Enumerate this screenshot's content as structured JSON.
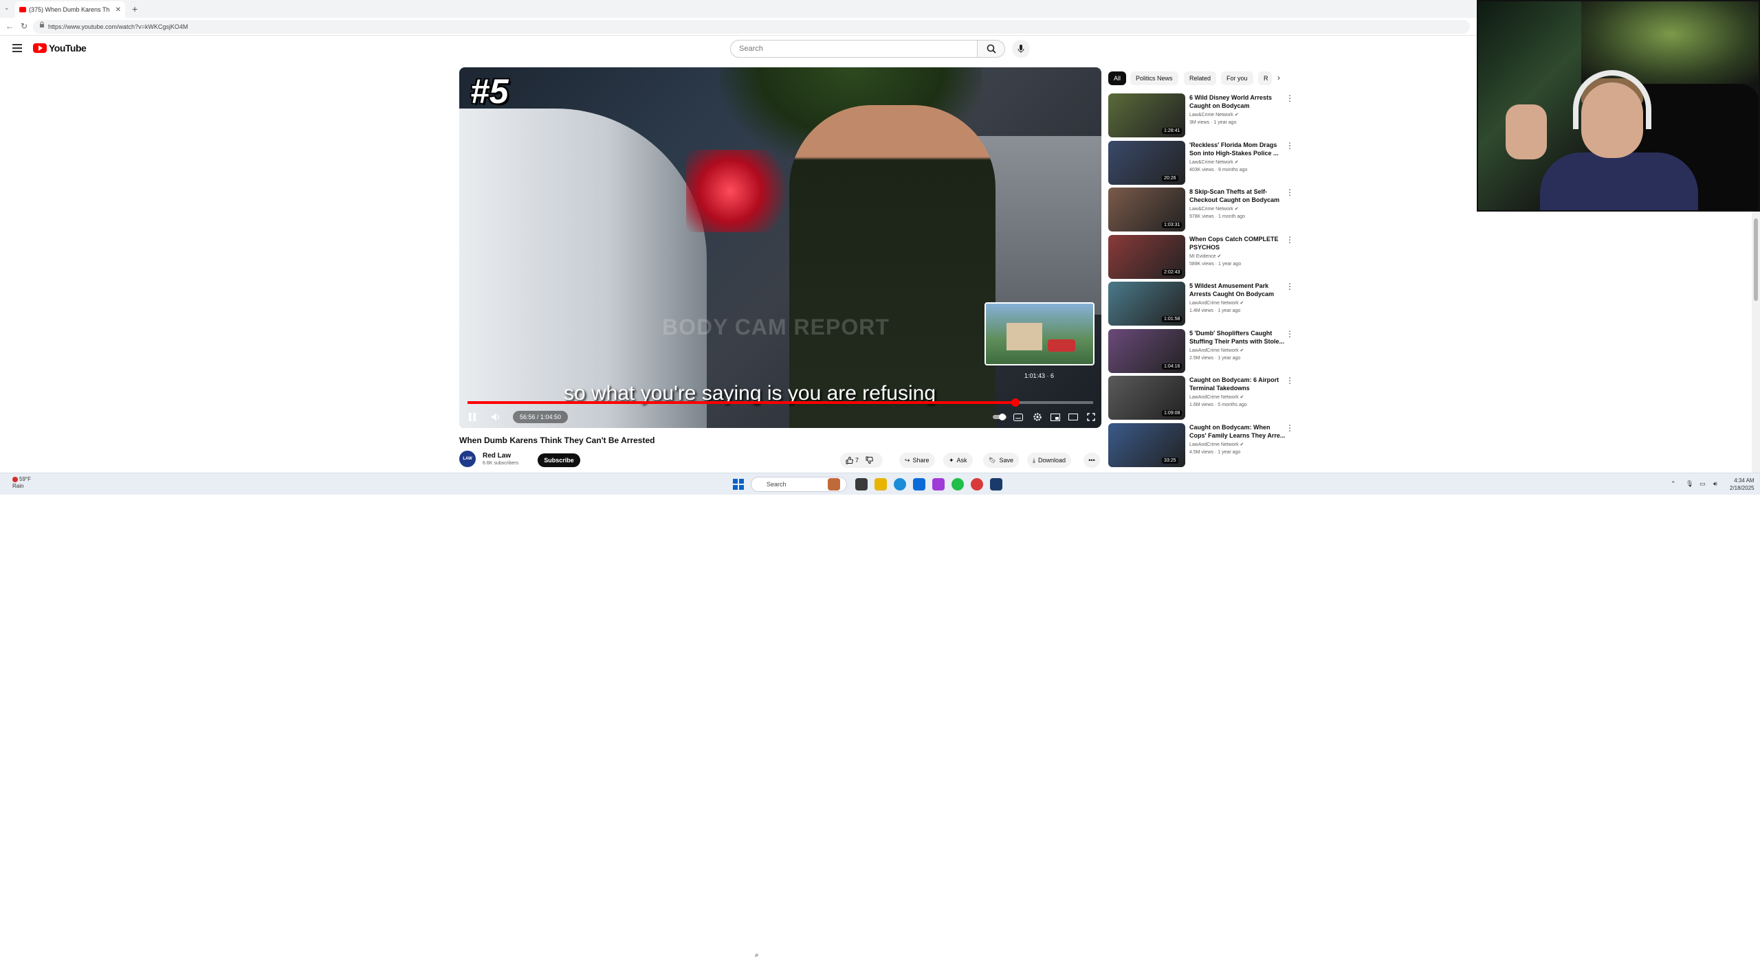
{
  "browser": {
    "tab_title": "(375) When Dumb Karens Th",
    "url": "https://www.youtube.com/watch?v=kWKCgsjKO4M"
  },
  "youtube": {
    "logo_text": "YouTube",
    "search_placeholder": "Search"
  },
  "player": {
    "rank_overlay": "#5",
    "watermark": "BODY CAM REPORT",
    "subtitle": "so what you're saying is you are refusing",
    "preview_time": "1:01:43 · 6",
    "current_time": "56:56 / 1:04:50",
    "progress_fraction": 0.876,
    "buffer_fraction": 0.91
  },
  "video": {
    "title": "When Dumb Karens Think They Can't Be Arrested",
    "channel": "Red Law",
    "subscribers": "6.6K subscribers",
    "avatar_text": "LAW",
    "subscribe_label": "Subscribe",
    "like_count": "7",
    "share_label": "Share",
    "ask_label": "Ask",
    "save_label": "Save",
    "download_label": "Download"
  },
  "chips": [
    "All",
    "Politics News",
    "Related",
    "For you",
    "R"
  ],
  "recommendations": [
    {
      "title": "6 Wild Disney World Arrests Caught on Bodycam",
      "channel": "Law&Crime Network",
      "meta": "3M views · 1 year ago",
      "duration": "1:28:41",
      "color": "#5a6b3a"
    },
    {
      "title": "'Reckless' Florida Mom Drags Son into High-Stakes Police ...",
      "channel": "Law&Crime Network",
      "meta": "403K views · 9 months ago",
      "duration": "20:26",
      "color": "#3a4a6a"
    },
    {
      "title": "8 Skip-Scan Thefts at Self-Checkout Caught on Bodycam",
      "channel": "Law&Crime Network",
      "meta": "978K views · 1 month ago",
      "duration": "1:03:31",
      "color": "#7a5a4a"
    },
    {
      "title": "When Cops Catch COMPLETE PSYCHOS",
      "channel": "MI Evidence",
      "meta": "589K views · 1 year ago",
      "duration": "2:02:43",
      "color": "#8a3a3a"
    },
    {
      "title": "5 Wildest Amusement Park Arrests Caught On Bodycam",
      "channel": "LawAndCrime Network",
      "meta": "1.4M views · 1 year ago",
      "duration": "1:01:58",
      "color": "#4a7a8a"
    },
    {
      "title": "5 'Dumb' Shoplifters Caught Stuffing Their Pants with Stole...",
      "channel": "LawAndCrime Network",
      "meta": "2.5M views · 1 year ago",
      "duration": "1:04:16",
      "color": "#6a4a7a"
    },
    {
      "title": "Caught on Bodycam: 6 Airport Terminal Takedowns",
      "channel": "LawAndCrime Network",
      "meta": "1.6M views · 5 months ago",
      "duration": "1:09:08",
      "color": "#5a5a5a"
    },
    {
      "title": "Caught on Bodycam: When Cops' Family Learns They Arre...",
      "channel": "LawAndCrime Network",
      "meta": "4.5M views · 1 year ago",
      "duration": "33:25",
      "color": "#3a5a8a"
    }
  ],
  "taskbar": {
    "weather_temp": "59°F",
    "weather_desc": "Rain",
    "search_label": "Search",
    "time": "4:34 AM",
    "date": "2/18/2025"
  }
}
